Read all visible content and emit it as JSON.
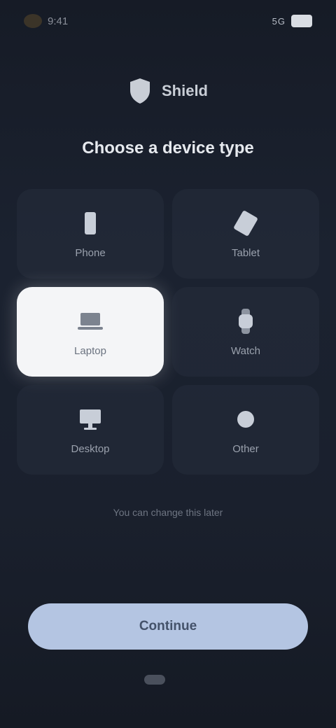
{
  "status_bar": {
    "time": "9:41",
    "signal": "5G"
  },
  "brand": {
    "name": "Shield",
    "icon": "shield-icon"
  },
  "title": "Choose a device type",
  "tiles": [
    {
      "label": "Phone",
      "icon": "phone-icon",
      "selected": false
    },
    {
      "label": "Tablet",
      "icon": "tablet-icon",
      "selected": false
    },
    {
      "label": "Laptop",
      "icon": "laptop-icon",
      "selected": true
    },
    {
      "label": "Watch",
      "icon": "watch-icon",
      "selected": false
    },
    {
      "label": "Desktop",
      "icon": "desktop-icon",
      "selected": false
    },
    {
      "label": "Other",
      "icon": "device-icon",
      "selected": false
    }
  ],
  "footnote": "You can change this later",
  "continue_label": "Continue",
  "colors": {
    "accent": "#b4c5e2",
    "background": "#1b2230",
    "selected_tile": "#f4f5f7"
  }
}
